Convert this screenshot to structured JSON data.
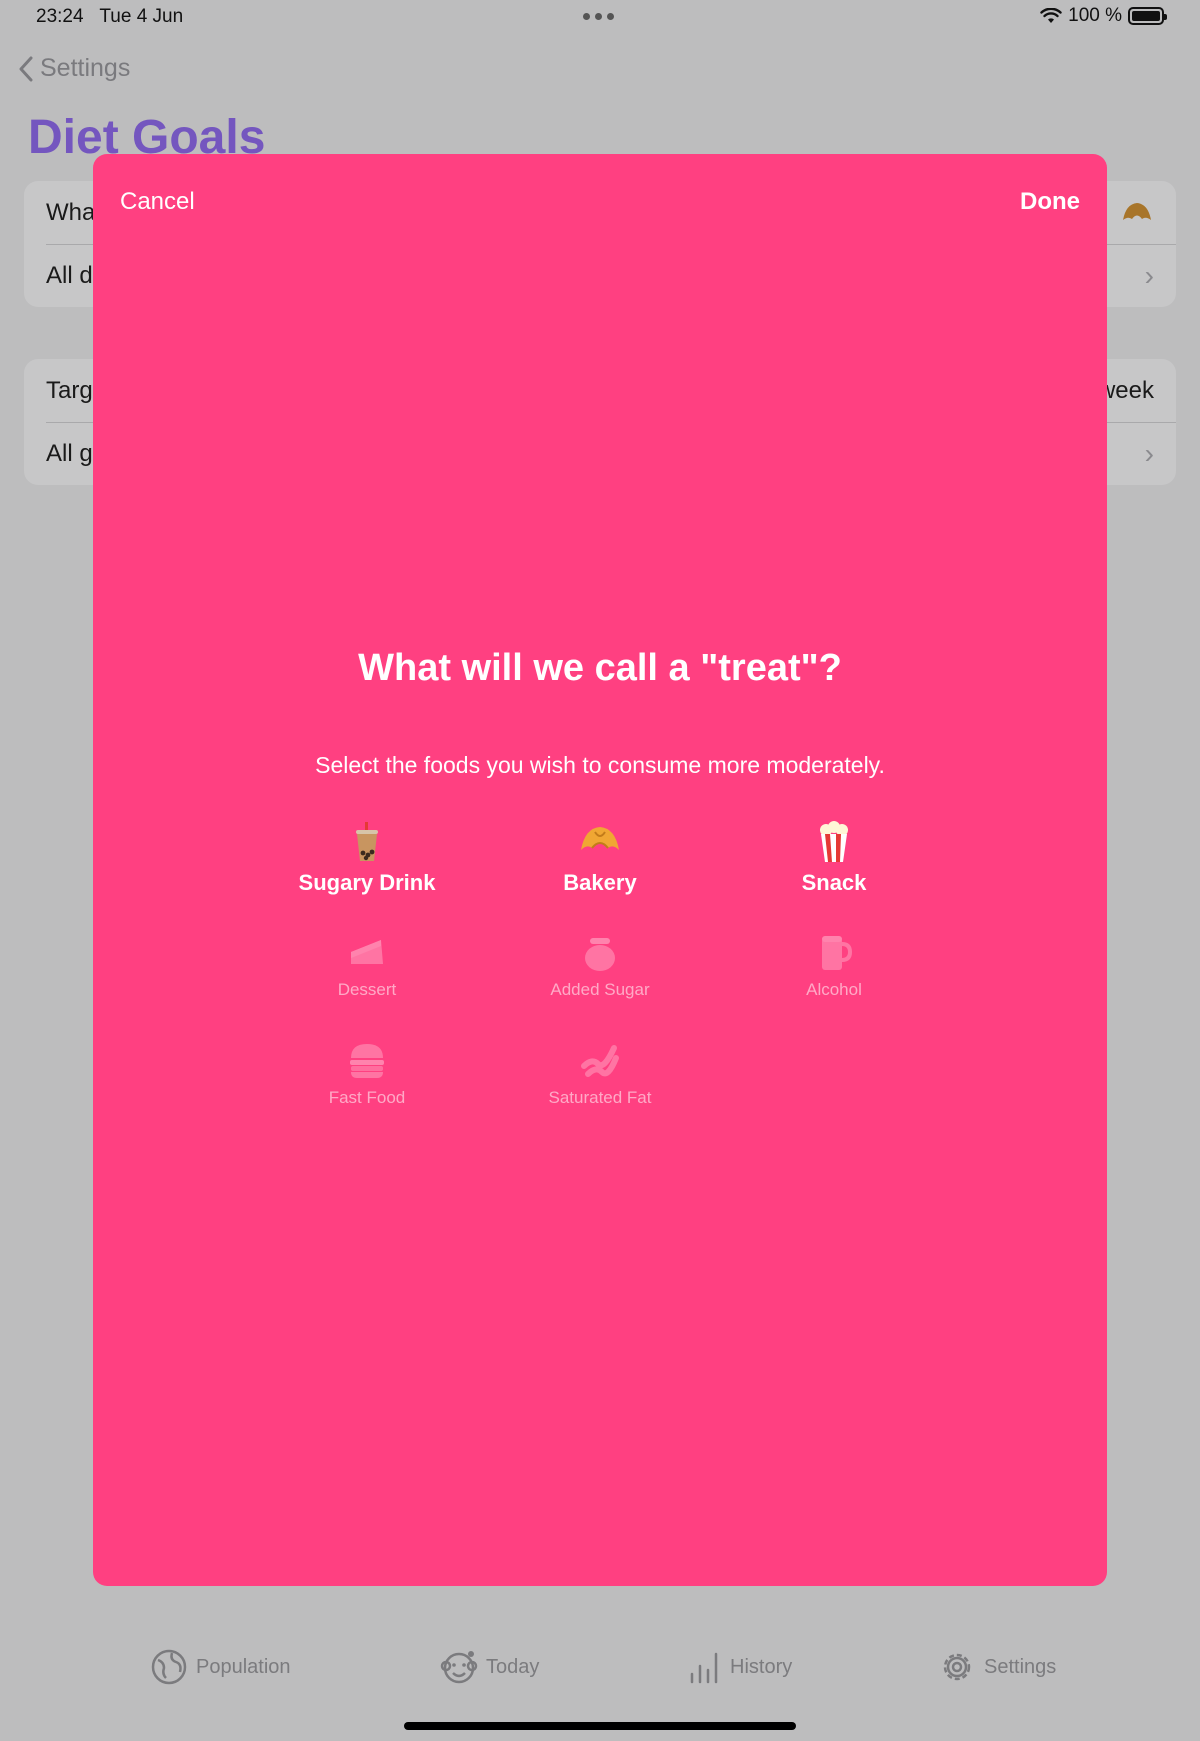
{
  "status": {
    "time": "23:24",
    "date": "Tue 4 Jun",
    "battery": "100 %",
    "battery_level": 1.0
  },
  "background": {
    "back_label": "Settings",
    "title": "Diet Goals",
    "group1": [
      {
        "label": "Wha",
        "trail": ""
      },
      {
        "label": "All d",
        "trail": ""
      }
    ],
    "group2": [
      {
        "label": "Targ",
        "trail": "week"
      },
      {
        "label": "All g",
        "trail": ""
      }
    ]
  },
  "modal": {
    "cancel_label": "Cancel",
    "done_label": "Done",
    "title": "What will we call a \"treat\"?",
    "subtitle": "Select the foods you wish to consume more moderately.",
    "options": [
      {
        "label": "Sugary Drink",
        "icon": "bubble-tea-icon",
        "selected": true
      },
      {
        "label": "Bakery",
        "icon": "croissant-icon",
        "selected": true
      },
      {
        "label": "Snack",
        "icon": "popcorn-icon",
        "selected": true
      },
      {
        "label": "Dessert",
        "icon": "cake-icon",
        "selected": false
      },
      {
        "label": "Added Sugar",
        "icon": "honey-pot-icon",
        "selected": false
      },
      {
        "label": "Alcohol",
        "icon": "beer-mug-icon",
        "selected": false
      },
      {
        "label": "Fast Food",
        "icon": "burger-icon",
        "selected": false
      },
      {
        "label": "Saturated Fat",
        "icon": "bacon-icon",
        "selected": false
      }
    ]
  },
  "tabs": [
    {
      "label": "Population",
      "icon": "globe-icon"
    },
    {
      "label": "Today",
      "icon": "monkey-face-icon"
    },
    {
      "label": "History",
      "icon": "bar-chart-icon"
    },
    {
      "label": "Settings",
      "icon": "gear-icon"
    }
  ],
  "colors": {
    "modal_bg": "#ff4081",
    "title_accent": "#6d4bc0",
    "dim_bg": "#bdbdbe"
  }
}
